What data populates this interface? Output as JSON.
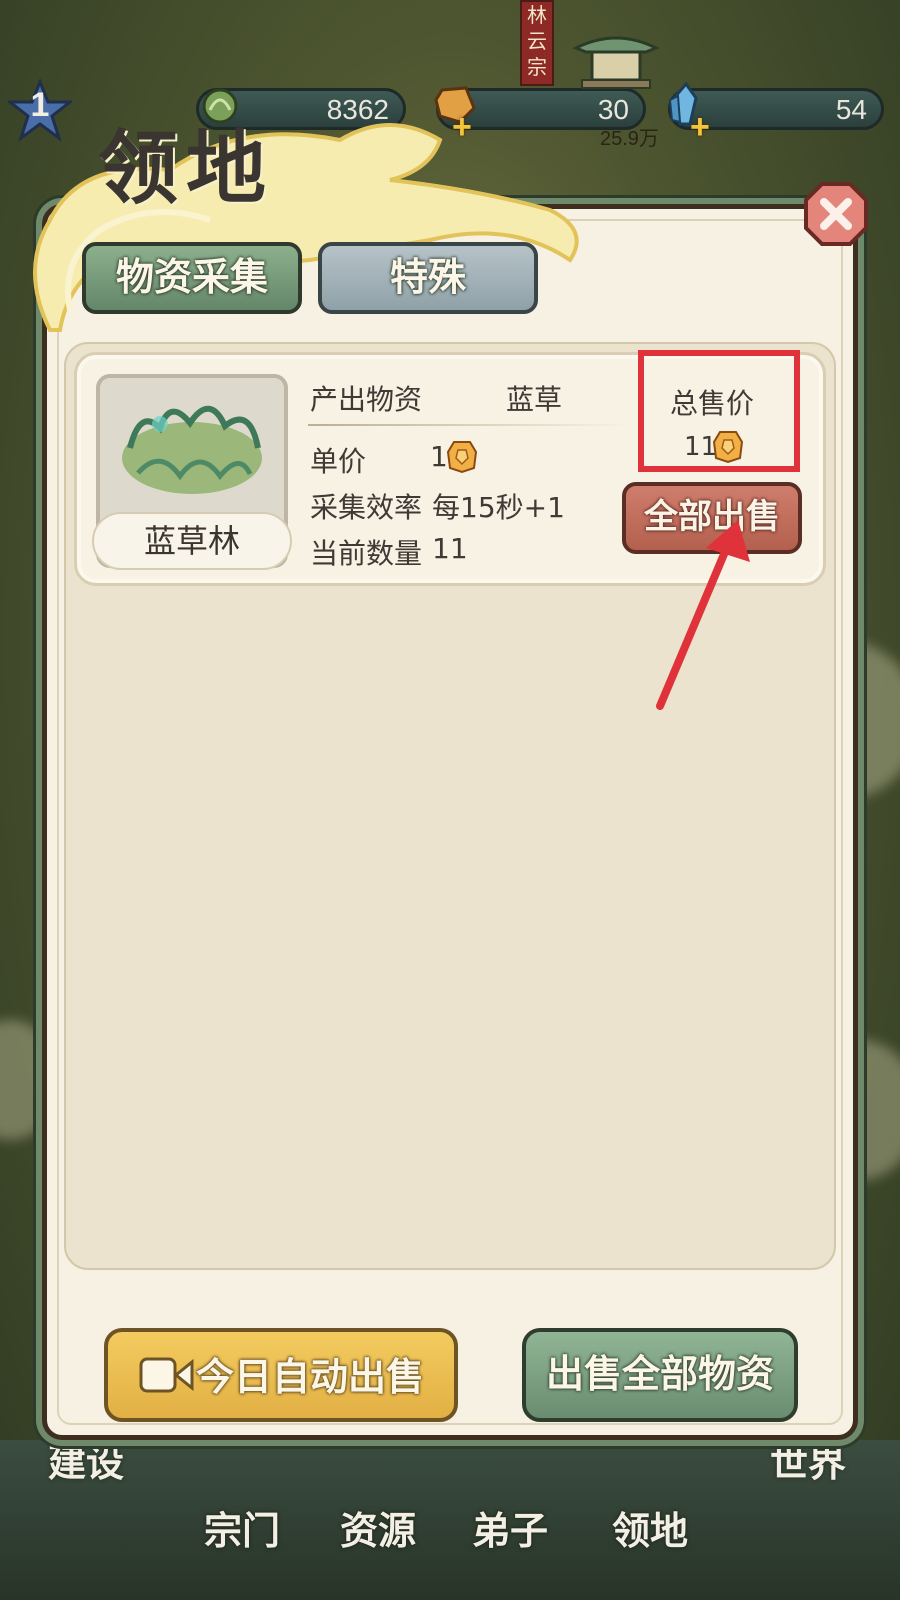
{
  "top_bar": {
    "level": "1",
    "sect_name": "林云宗",
    "resources": [
      {
        "icon": "herb-icon",
        "value": "8362"
      },
      {
        "icon": "ore-icon",
        "value": "30"
      },
      {
        "icon": "crystal-icon",
        "value": "54"
      }
    ],
    "power_text": "25.9万"
  },
  "dialog": {
    "title": "领地",
    "tabs": [
      {
        "label": "物资采集",
        "active": true
      },
      {
        "label": "特殊",
        "active": false
      }
    ]
  },
  "card": {
    "name": "蓝草林",
    "output_label": "产出物资",
    "output_value": "蓝草",
    "unit_price_label": "单价",
    "unit_price_value": "1",
    "efficiency_label": "采集效率",
    "efficiency_value": "每15秒+1",
    "quantity_label": "当前数量",
    "quantity_value": "11",
    "total_price_label": "总售价",
    "total_price_value": "11",
    "sell_all_label": "全部出售"
  },
  "bottom_buttons": {
    "auto_sell_label": "今日自动出售",
    "sell_resources_label": "出售全部物资"
  },
  "bottom_nav": {
    "left_partial": "建设",
    "items": [
      "宗门",
      "资源",
      "弟子",
      "领地"
    ],
    "right_partial": "世界"
  },
  "colors": {
    "highlight": "#e0323a",
    "sell_button": "#c26c5b",
    "auto_button": "#eabf52",
    "green_button": "#7ea183"
  }
}
